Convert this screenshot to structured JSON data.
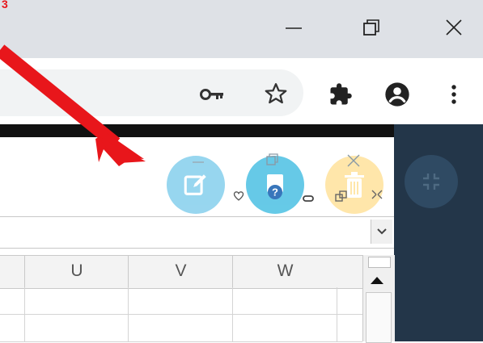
{
  "annotation": {
    "arrow_color": "#e8161b"
  },
  "window": {
    "minimize_icon": "minimize-icon",
    "restore_icon": "restore-icon",
    "close_icon": "close-icon"
  },
  "toolbar": {
    "key_icon": "key-icon",
    "star_icon": "star-icon",
    "extensions_icon": "puzzle-icon",
    "profile_icon": "account-icon",
    "menu_icon": "kebab-menu-icon"
  },
  "sheet": {
    "columns": [
      "U",
      "V",
      "W"
    ]
  },
  "floating": {
    "edit_color": "#8fd3ee",
    "help_color": "#5ec7e6",
    "delete_color": "#ffe4a3",
    "collapse_color": "#2f4a63"
  }
}
